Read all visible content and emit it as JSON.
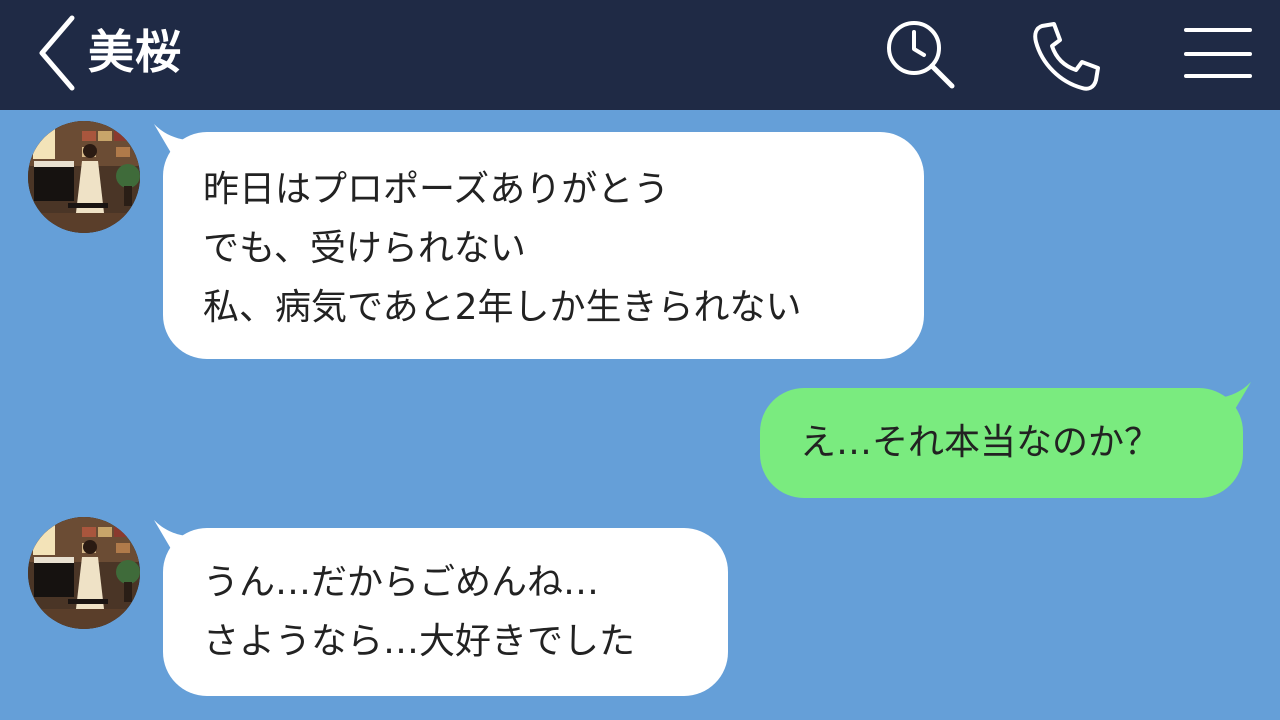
{
  "header": {
    "title": "美桜",
    "back_icon": "chevron-left-icon",
    "search_icon": "search-icon",
    "call_icon": "phone-icon",
    "menu_icon": "hamburger-menu-icon",
    "background_color": "#1f2a45"
  },
  "chat": {
    "background_color": "#659fd8",
    "messages": [
      {
        "side": "incoming",
        "bubble_color": "#ffffff",
        "lines": [
          "昨日はプロポーズありがとう",
          "でも、受けられない",
          "私、病気であと2年しか生きられない"
        ]
      },
      {
        "side": "outgoing",
        "bubble_color": "#7aeb7f",
        "lines": [
          "え…それ本当なのか？"
        ]
      },
      {
        "side": "incoming",
        "bubble_color": "#ffffff",
        "lines": [
          "うん…だからごめんね…",
          "さようなら…大好きでした"
        ]
      }
    ]
  }
}
